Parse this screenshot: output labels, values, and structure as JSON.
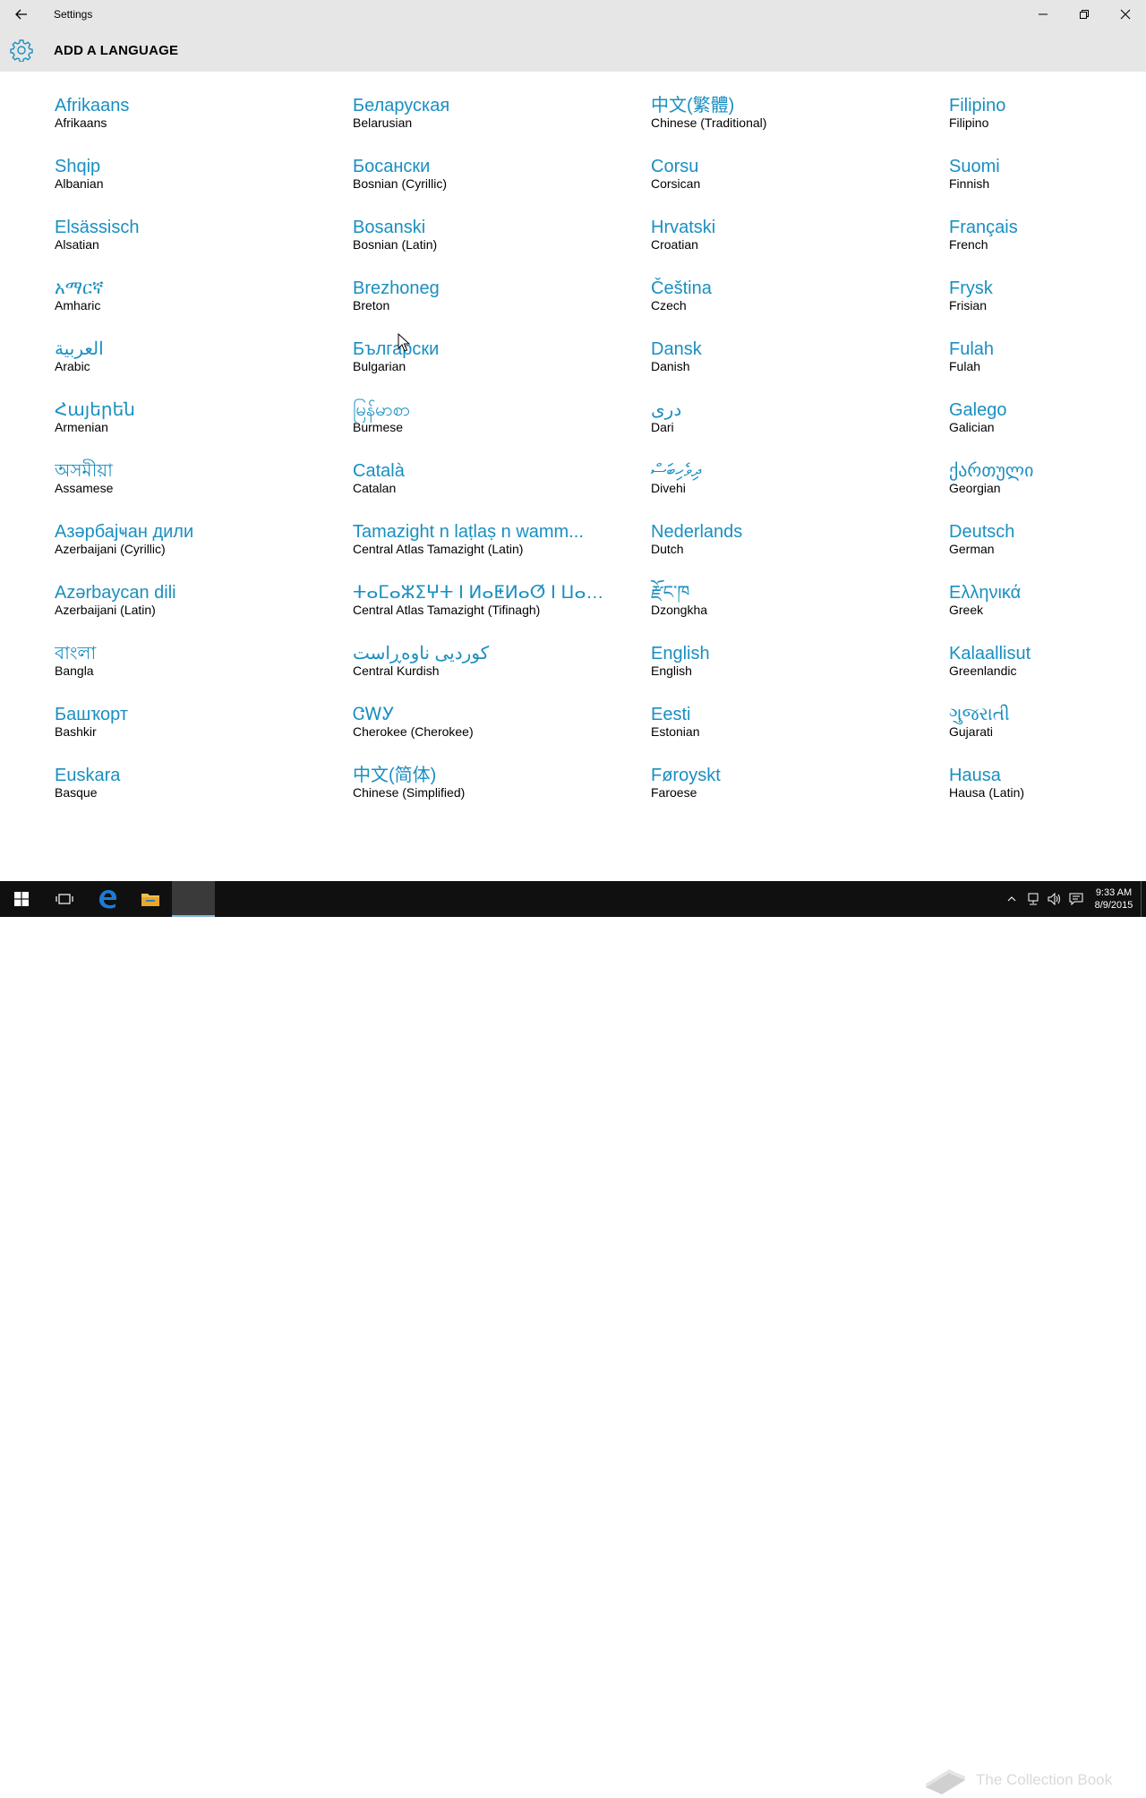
{
  "window": {
    "title": "Settings"
  },
  "header": {
    "title": "ADD A LANGUAGE"
  },
  "colors": {
    "accent": "#1a8fc1",
    "titlebar": "#e6e6e6",
    "taskbar": "#101010"
  },
  "languages": [
    {
      "native": "Afrikaans",
      "english": "Afrikaans"
    },
    {
      "native": "Shqip",
      "english": "Albanian"
    },
    {
      "native": "Elsässisch",
      "english": "Alsatian"
    },
    {
      "native": "አማርኛ",
      "english": "Amharic"
    },
    {
      "native": "العربية",
      "english": "Arabic"
    },
    {
      "native": "Հայերեն",
      "english": "Armenian"
    },
    {
      "native": "অসমীয়া",
      "english": "Assamese"
    },
    {
      "native": "Азәрбајҹан дили",
      "english": "Azerbaijani (Cyrillic)"
    },
    {
      "native": "Azərbaycan dili",
      "english": "Azerbaijani (Latin)"
    },
    {
      "native": "বাংলা",
      "english": "Bangla"
    },
    {
      "native": "Башҡорт",
      "english": "Bashkir"
    },
    {
      "native": "Euskara",
      "english": "Basque"
    },
    {
      "native": "Беларуская",
      "english": "Belarusian"
    },
    {
      "native": "Босански",
      "english": "Bosnian (Cyrillic)"
    },
    {
      "native": "Bosanski",
      "english": "Bosnian (Latin)"
    },
    {
      "native": "Brezhoneg",
      "english": "Breton"
    },
    {
      "native": "Български",
      "english": "Bulgarian"
    },
    {
      "native": "မြန်မာစာ",
      "english": "Burmese"
    },
    {
      "native": "Català",
      "english": "Catalan"
    },
    {
      "native": "Tamazight n laṭlaṣ n wamm...",
      "english": "Central Atlas Tamazight (Latin)"
    },
    {
      "native": "ⵜⴰⵎⴰⵣⵉⵖⵜ ⵏ ⵍⴰⵟⵍⴰⵚ ⵏ ⵡⴰⵎⵎⴰⵙ",
      "english": "Central Atlas Tamazight (Tifinagh)"
    },
    {
      "native": "کوردیی ناوەڕاست",
      "english": "Central Kurdish"
    },
    {
      "native": "ᏣᎳᎩ",
      "english": "Cherokee (Cherokee)"
    },
    {
      "native": "中文(简体)",
      "english": "Chinese (Simplified)"
    },
    {
      "native": "中文(繁體)",
      "english": "Chinese (Traditional)"
    },
    {
      "native": "Corsu",
      "english": "Corsican"
    },
    {
      "native": "Hrvatski",
      "english": "Croatian"
    },
    {
      "native": "Čeština",
      "english": "Czech"
    },
    {
      "native": "Dansk",
      "english": "Danish"
    },
    {
      "native": "درى",
      "english": "Dari"
    },
    {
      "native": "ދިވެހިބަސް",
      "english": "Divehi"
    },
    {
      "native": "Nederlands",
      "english": "Dutch"
    },
    {
      "native": "རྫོང་ཁ",
      "english": "Dzongkha"
    },
    {
      "native": "English",
      "english": "English"
    },
    {
      "native": "Eesti",
      "english": "Estonian"
    },
    {
      "native": "Føroyskt",
      "english": "Faroese"
    },
    {
      "native": "Filipino",
      "english": "Filipino"
    },
    {
      "native": "Suomi",
      "english": "Finnish"
    },
    {
      "native": "Français",
      "english": "French"
    },
    {
      "native": "Frysk",
      "english": "Frisian"
    },
    {
      "native": "Fulah",
      "english": "Fulah"
    },
    {
      "native": "Galego",
      "english": "Galician"
    },
    {
      "native": "ქართული",
      "english": "Georgian"
    },
    {
      "native": "Deutsch",
      "english": "German"
    },
    {
      "native": "Ελληνικά",
      "english": "Greek"
    },
    {
      "native": "Kalaallisut",
      "english": "Greenlandic"
    },
    {
      "native": "ગુજરાતી",
      "english": "Gujarati"
    },
    {
      "native": "Hausa",
      "english": "Hausa (Latin)"
    }
  ],
  "taskbar": {
    "time": "9:33 AM",
    "date": "8/9/2015",
    "watermark": "The Collection Book"
  }
}
